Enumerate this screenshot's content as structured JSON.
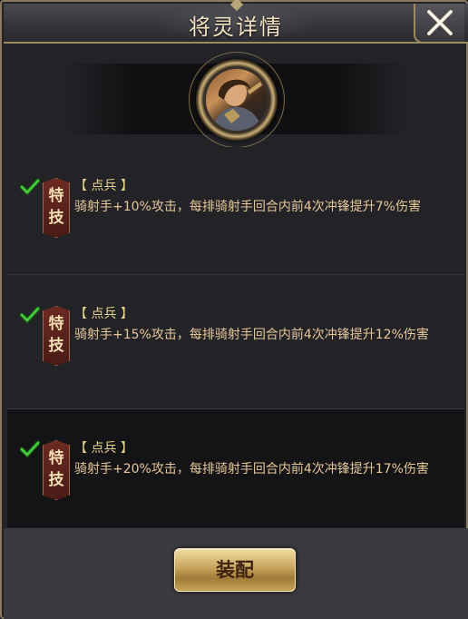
{
  "header": {
    "title": "将灵详情"
  },
  "icons": {
    "close": "close-icon",
    "check": "check-icon",
    "avatar": "general-portrait"
  },
  "skills": [
    {
      "badge_top": "特",
      "badge_bottom": "技",
      "tag": "【 点兵 】",
      "desc": "骑射手+10%攻击，每排骑射手回合内前4次冲锋提升7%伤害",
      "selected": true
    },
    {
      "badge_top": "特",
      "badge_bottom": "技",
      "tag": "【 点兵 】",
      "desc": "骑射手+15%攻击，每排骑射手回合内前4次冲锋提升12%伤害",
      "selected": true
    },
    {
      "badge_top": "特",
      "badge_bottom": "技",
      "tag": "【 点兵 】",
      "desc": "骑射手+20%攻击，每排骑射手回合内前4次冲锋提升17%伤害",
      "selected": true
    }
  ],
  "footer": {
    "equip_label": "装配"
  },
  "colors": {
    "accent_gold": "#c8a55c",
    "text_gold": "#e6c79a",
    "badge_red": "#6b2a22",
    "check_green": "#3fbf3a"
  }
}
